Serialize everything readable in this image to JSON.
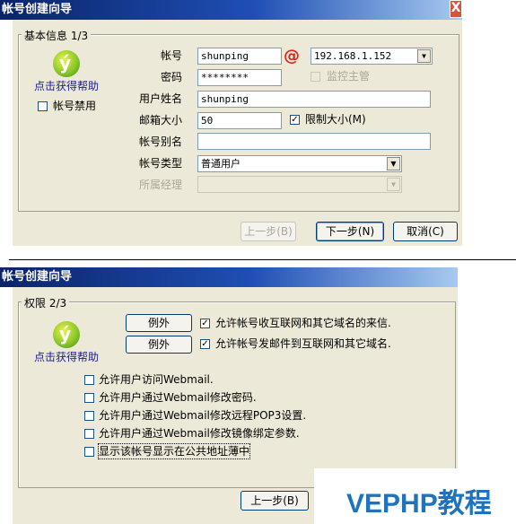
{
  "wizard1": {
    "title": "帐号创建向导",
    "close": "X",
    "group_label": "基本信息 1/3",
    "help_link": "点击获得帮助",
    "account_disabled_label": "帐号禁用",
    "account_disabled_checked": false,
    "account_label": "帐号",
    "account_value": "shunping",
    "domain_value": "192.168.1.152",
    "password_label": "密码",
    "password_value": "********",
    "supervisor_label": "监控主管",
    "supervisor_checked": false,
    "username_label": "用户姓名",
    "username_value": "shunping",
    "mailbox_size_label": "邮箱大小",
    "mailbox_size_value": "50",
    "limit_size_label": "限制大小(M)",
    "limit_size_checked": true,
    "alias_label": "帐号别名",
    "alias_value": "",
    "account_type_label": "帐号类型",
    "account_type_value": "普通用户",
    "manager_label": "所属经理",
    "manager_value": "",
    "prev_button": "上一步(B)",
    "next_button": "下一步(N)",
    "cancel_button": "取消(C)"
  },
  "wizard2": {
    "title": "帐号创建向导",
    "group_label": "权限 2/3",
    "help_link": "点击获得帮助",
    "exception_button_1": "例外",
    "exception_button_2": "例外",
    "permissions": [
      {
        "label": "允许帐号收互联网和其它域名的来信.",
        "checked": true
      },
      {
        "label": "允许帐号发邮件到互联网和其它域名.",
        "checked": true
      },
      {
        "label": "允许用户访问Webmail.",
        "checked": false
      },
      {
        "label": "允许用户通过Webmail修改密码.",
        "checked": false
      },
      {
        "label": "允许用户通过Webmail修改远程POP3设置.",
        "checked": false
      },
      {
        "label": "允许用户通过Webmail修改镜像绑定参数.",
        "checked": false
      },
      {
        "label": "显示该帐号显示在公共地址薄中",
        "checked": false
      }
    ],
    "prev_button": "上一步(B)"
  },
  "watermark": "VEPHP教程",
  "colors": {
    "titlebar": "#0a246a",
    "dialog_bg": "#ece9d8",
    "accent_red": "#d9261c",
    "help_link": "#1a1a9a",
    "watermark": "#1e73be"
  },
  "icons": {
    "logo": "green-y-logo-icon",
    "at": "at-sign-icon",
    "dropdown": "chevron-down-icon"
  }
}
